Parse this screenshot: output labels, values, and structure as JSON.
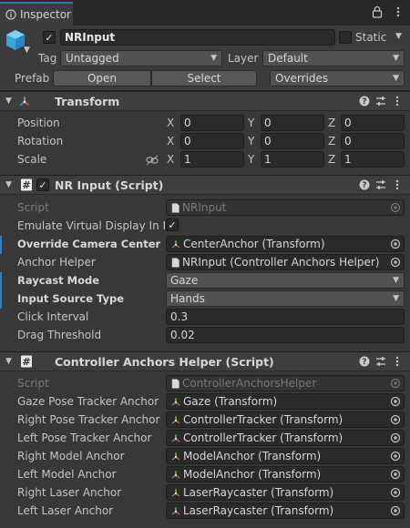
{
  "window": {
    "tab_title": "Inspector"
  },
  "header": {
    "active_checked": true,
    "object_name": "NRInput",
    "static_label": "Static",
    "tag_label": "Tag",
    "tag_value": "Untagged",
    "layer_label": "Layer",
    "layer_value": "Default",
    "prefab_label": "Prefab",
    "prefab_open": "Open",
    "prefab_select": "Select",
    "prefab_overrides": "Overrides"
  },
  "transform": {
    "title": "Transform",
    "position_label": "Position",
    "rotation_label": "Rotation",
    "scale_label": "Scale",
    "axis_x": "X",
    "axis_y": "Y",
    "axis_z": "Z",
    "position": {
      "x": "0",
      "y": "0",
      "z": "0"
    },
    "rotation": {
      "x": "0",
      "y": "0",
      "z": "0"
    },
    "scale": {
      "x": "1",
      "y": "1",
      "z": "1"
    }
  },
  "nr_input": {
    "title": "NR Input (Script)",
    "enabled": true,
    "script_label": "Script",
    "script_value": "NRInput",
    "emulate_label": "Emulate Virtual Display In E",
    "emulate_checked": true,
    "override_camera_label": "Override Camera Center",
    "override_camera_value": "CenterAnchor (Transform)",
    "anchor_helper_label": "Anchor Helper",
    "anchor_helper_value": "NRInput (Controller Anchors Helper)",
    "raycast_mode_label": "Raycast Mode",
    "raycast_mode_value": "Gaze",
    "input_source_label": "Input Source Type",
    "input_source_value": "Hands",
    "click_interval_label": "Click Interval",
    "click_interval_value": "0.3",
    "drag_threshold_label": "Drag Threshold",
    "drag_threshold_value": "0.02"
  },
  "anchors_helper": {
    "title": "Controller Anchors Helper (Script)",
    "script_label": "Script",
    "script_value": "ControllerAnchorsHelper",
    "rows": [
      {
        "label": "Gaze Pose Tracker Anchor",
        "value": "Gaze (Transform)"
      },
      {
        "label": "Right Pose Tracker Anchor",
        "value": "ControllerTracker (Transform)"
      },
      {
        "label": "Left Pose Tracker Anchor",
        "value": "ControllerTracker (Transform)"
      },
      {
        "label": "Right Model Anchor",
        "value": "ModelAnchor (Transform)"
      },
      {
        "label": "Left Model Anchor",
        "value": "ModelAnchor (Transform)"
      },
      {
        "label": "Right Laser Anchor",
        "value": "LaserRaycaster (Transform)"
      },
      {
        "label": "Left Laser Anchor",
        "value": "LaserRaycaster (Transform)"
      }
    ]
  },
  "colors": {
    "accent": "#3a79bb",
    "panel": "#383838",
    "field": "#2a2a2a"
  },
  "icons": [
    "info-icon",
    "lock-icon",
    "menu-icon",
    "cube-icon",
    "transform-axes-icon",
    "script-icon",
    "help-icon",
    "preset-icon",
    "more-icon",
    "link-icon",
    "object-picker-icon"
  ]
}
